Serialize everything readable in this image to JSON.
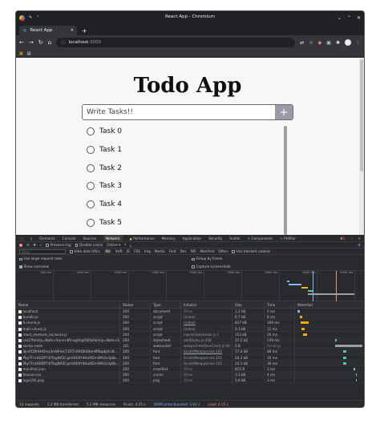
{
  "window": {
    "title": "React App - Chromium"
  },
  "tab": {
    "label": "React App"
  },
  "address": {
    "host": "localhost",
    "port": ":3000"
  },
  "app": {
    "title": "Todo App",
    "input_placeholder": "Write Tasks!!",
    "add_label": "+"
  },
  "tasks": [
    "Task 0",
    "Task 1",
    "Task 2",
    "Task 3",
    "Task 4",
    "Task 5"
  ],
  "devtools": {
    "tabs": [
      "Elements",
      "Console",
      "Sources",
      "Network",
      "Performance",
      "Memory",
      "Application",
      "Security",
      "Audits",
      "Components",
      "Profiler"
    ],
    "active_tab": "Network",
    "error_count": "1",
    "preserve_log": "Preserve log",
    "disable_cache": "Disable cache",
    "throttle": "Online",
    "filter_placeholder": "Filter",
    "hide_data_urls": "Hide data URLs",
    "filter_types": [
      "All",
      "XHR",
      "JS",
      "CSS",
      "Img",
      "Media",
      "Font",
      "Doc",
      "WS",
      "Manifest",
      "Other"
    ],
    "has_blocked_cookies": "Has blocked cookies",
    "use_large_rows": "Use large request rows",
    "group_by_frame": "Group by frame",
    "show_overview": "Show overview",
    "capture_screenshots": "Capture screenshots",
    "ticks": [
      "500 ms",
      "1000 ms",
      "1500 ms",
      "2000 ms",
      "2500 ms",
      "3000 ms",
      "3500 ms",
      "4000 ms",
      "4500 ms"
    ],
    "columns": [
      "Name",
      "Status",
      "Type",
      "Initiator",
      "Size",
      "Time",
      "Waterfall"
    ],
    "rows": [
      {
        "name": "localhost",
        "status": "200",
        "type": "document",
        "initiator": "Other",
        "size": "1.2 kB",
        "time": "5 ms"
      },
      {
        "name": "bundle.js",
        "status": "200",
        "type": "script",
        "initiator": "(index)",
        "size": "6.7 kB",
        "time": "8 ms"
      },
      {
        "name": "0.chunk.js",
        "status": "200",
        "type": "script",
        "initiator": "(index)",
        "size": "837 kB",
        "time": "166 ms"
      },
      {
        "name": "main.chunk.js",
        "status": "200",
        "type": "script",
        "initiator": "(index)",
        "size": "9.3 kB",
        "time": "11 ms"
      },
      {
        "name": "react_devtools_backend.js",
        "status": "200",
        "type": "script",
        "initiator": "injectGlobalHook.js:1",
        "size": "153 kB",
        "time": "26 ms"
      },
      {
        "name": "css2?family=Noto+Sans+KR:wght@500&family=Noto+Se...",
        "status": "200",
        "type": "stylesheet",
        "initiator": "addStyles.js:358",
        "size": "37.2 kB",
        "time": "139 ms"
      },
      {
        "name": "sockjs-node",
        "status": "101",
        "type": "websocket",
        "initiator": "webpackHotDevClient.js:60",
        "size": "0 B",
        "time": "Pending"
      },
      {
        "name": "3Jn4XDfr8HQmz3mWhHcTZXTnXRDEtXbmMXbpbJXcdt...",
        "status": "200",
        "type": "font",
        "initiator": "Scroll/Weapper.tsx:101",
        "size": "17.4 kB",
        "time": "48 ms"
      },
      {
        "name": "PbyTFmXiEBPT4ITbgNA5CgmOtE9YdHuMZmWAOcdyBb...",
        "status": "200",
        "type": "font",
        "initiator": "Scroll/Weapper.tsx:101",
        "size": "24.3 kB",
        "time": "35 ms"
      },
      {
        "name": "PbyTFmXiEBPT4ITbgNA5CgmOtE9YdHuMZmWAOcdyBb...",
        "status": "200",
        "type": "font",
        "initiator": "Scroll/Weapper.tsx:101",
        "size": "24.3 kB",
        "time": "36 ms"
      },
      {
        "name": "manifest.json",
        "status": "200",
        "type": "manifest",
        "initiator": "Other",
        "size": "815 B",
        "time": "3 ms"
      },
      {
        "name": "favicon.ico",
        "status": "200",
        "type": "x-icon",
        "initiator": "Other",
        "size": "3.3 kB",
        "time": "4 ms"
      },
      {
        "name": "logo192.png",
        "status": "200",
        "type": "png",
        "initiator": "Other",
        "size": "5.6 kB",
        "time": "3 ms"
      }
    ],
    "status": {
      "requests": "13 requests",
      "transferred": "1.2 MB transferred",
      "resources": "5.2 MB resources",
      "finish": "Finish: 4.25 s",
      "dom_loaded": "DOMContentLoaded: 3.63 s",
      "load": "Load: 4.25 s"
    }
  },
  "colors": {
    "accent": "#9a9aa6",
    "blue": "#8ab4f8",
    "red": "#f28b82",
    "teal": "#4ec9b0"
  }
}
